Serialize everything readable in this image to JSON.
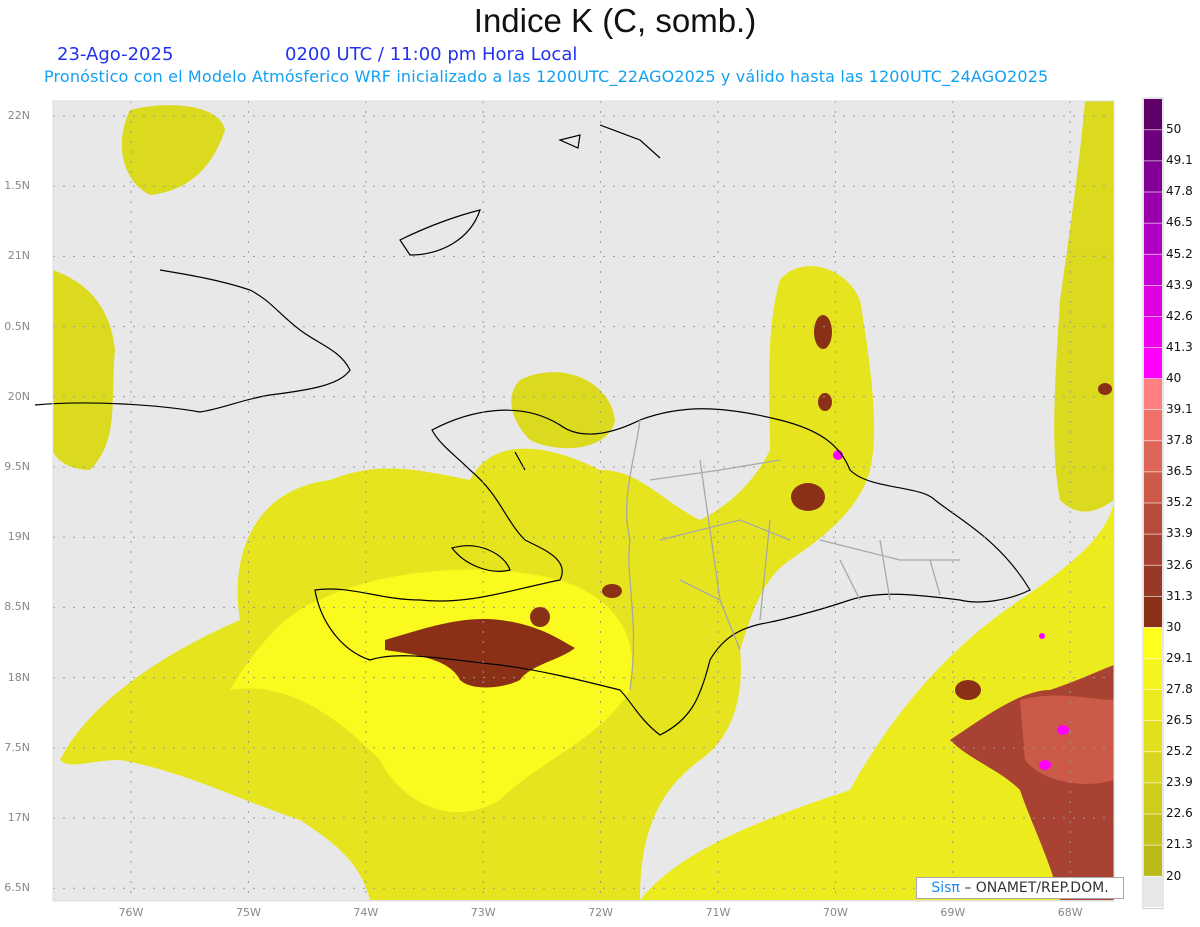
{
  "header": {
    "title": "Indice K (C, somb.)",
    "date": "23-Ago-2025",
    "time": "0200 UTC / 11:00 pm Hora Local",
    "subtitle": "Pronóstico con el Modelo Atmósferico WRF inicializado a las 1200UTC_22AGO2025 y válido hasta las  1200UTC_24AGO2025"
  },
  "axes": {
    "lat_labels": [
      "22N",
      "1.5N",
      "21N",
      "0.5N",
      "20N",
      "9.5N",
      "19N",
      "8.5N",
      "18N",
      "7.5N",
      "17N",
      "6.5N"
    ],
    "lat_values": [
      22,
      21.5,
      21,
      20.5,
      20,
      19.5,
      19,
      18.5,
      18,
      17.5,
      17,
      16.5
    ],
    "lon_labels": [
      "76W",
      "75W",
      "74W",
      "73W",
      "72W",
      "71W",
      "70W",
      "69W",
      "68W"
    ],
    "lon_values": [
      76,
      75,
      74,
      73,
      72,
      71,
      70,
      69,
      68
    ]
  },
  "colorbar": {
    "labels": [
      "50",
      "49.1",
      "47.8",
      "46.5",
      "45.2",
      "43.9",
      "42.6",
      "41.3",
      "40",
      "39.1",
      "37.8",
      "36.5",
      "35.2",
      "33.9",
      "32.6",
      "31.3",
      "30",
      "29.1",
      "27.8",
      "26.5",
      "25.2",
      "23.9",
      "22.6",
      "21.3",
      "20"
    ],
    "colors": [
      "#5e0068",
      "#6e0080",
      "#820096",
      "#9800ac",
      "#b000c4",
      "#c800d6",
      "#dc00e2",
      "#ee00ee",
      "#ff00ff",
      "#ff8080",
      "#ee7068",
      "#de6658",
      "#cc5a48",
      "#b84c3c",
      "#a84232",
      "#983826",
      "#8a3016",
      "#ffff1e",
      "#f6f41e",
      "#eceb1e",
      "#e2e01e",
      "#d8d61e",
      "#cecd1c",
      "#c4c31c",
      "#babb1a",
      "#e8e8e8"
    ]
  },
  "credit": {
    "brand": "Sisπ",
    "text": "– ONAMET/REP.DOM."
  },
  "colors": {
    "background": "#e8e8e8",
    "coast": "#000000",
    "borders": "#a8a8a8"
  }
}
